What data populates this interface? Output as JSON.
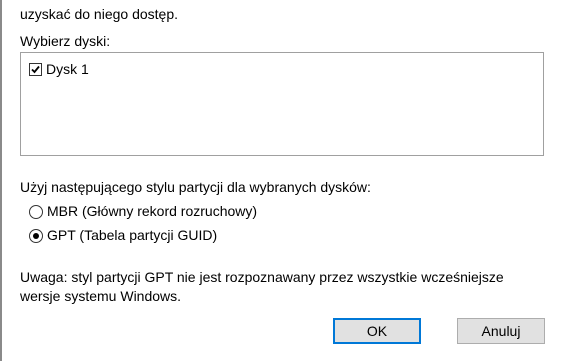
{
  "dialog": {
    "intro_text": "uzyskać do niego dostęp.",
    "select_disks_label": "Wybierz dyski:",
    "disks": [
      {
        "label": "Dysk 1",
        "checked": true
      }
    ],
    "partition_style_label": "Użyj następującego stylu partycji dla wybranych dysków:",
    "partition_options": [
      {
        "label": "MBR (Główny rekord rozruchowy)",
        "selected": false
      },
      {
        "label": "GPT (Tabela partycji GUID)",
        "selected": true
      }
    ],
    "note_line1": "Uwaga: styl partycji GPT nie jest rozpoznawany przez wszystkie wcześniejsze",
    "note_line2": "wersje systemu Windows.",
    "ok_label": "OK",
    "cancel_label": "Anuluj"
  },
  "colors": {
    "accent": "#0078d7",
    "button_bg": "#e1e1e1"
  }
}
